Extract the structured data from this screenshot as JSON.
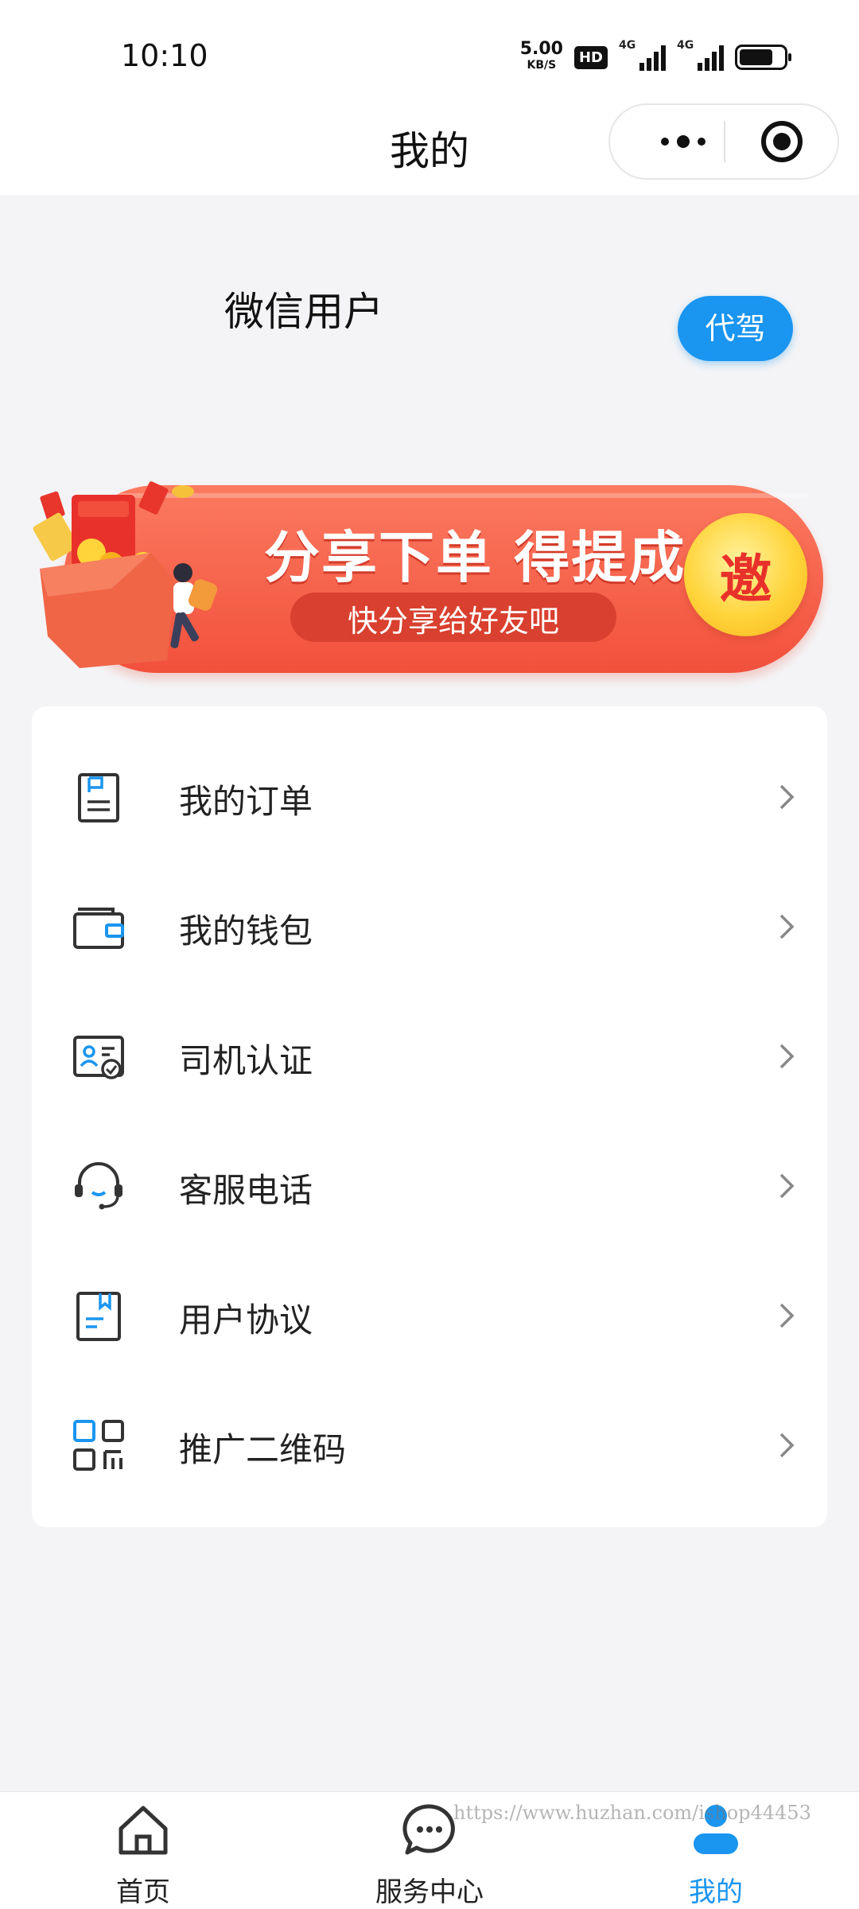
{
  "status_bar": {
    "time": "10:10",
    "net_speed": "5.00",
    "net_unit": "KB/S",
    "hd_badge": "HD",
    "signal_1_label": "4G",
    "signal_2_label": "4G",
    "battery_level": 0.75
  },
  "nav": {
    "title": "我的",
    "more_icon": "more-dots-icon",
    "close_icon": "target-circle-icon"
  },
  "profile": {
    "username": "微信用户",
    "role_badge": "代驾"
  },
  "banner": {
    "title": "分享下单 得提成",
    "subtitle": "快分享给好友吧",
    "invite": "邀",
    "colors": {
      "pill": "#f2503c",
      "invite": "#ffd43a",
      "invite_text": "#e8312a"
    }
  },
  "menu": {
    "items": [
      {
        "label": "我的订单",
        "icon": "order-document-icon"
      },
      {
        "label": "我的钱包",
        "icon": "wallet-icon"
      },
      {
        "label": "司机认证",
        "icon": "driver-id-card-icon"
      },
      {
        "label": "客服电话",
        "icon": "headset-icon"
      },
      {
        "label": "用户协议",
        "icon": "agreement-book-icon"
      },
      {
        "label": "推广二维码",
        "icon": "qr-code-icon"
      }
    ]
  },
  "tabs": [
    {
      "label": "首页",
      "icon": "home-icon",
      "active": false
    },
    {
      "label": "服务中心",
      "icon": "chat-bubble-icon",
      "active": false
    },
    {
      "label": "我的",
      "icon": "user-icon",
      "active": true
    }
  ],
  "watermark": "https://www.huzhan.com/ishop44453",
  "colors": {
    "accent": "#1a95f0",
    "background": "#f4f4f6",
    "icon_accent": "#1a95f0",
    "icon_dark": "#333333"
  }
}
